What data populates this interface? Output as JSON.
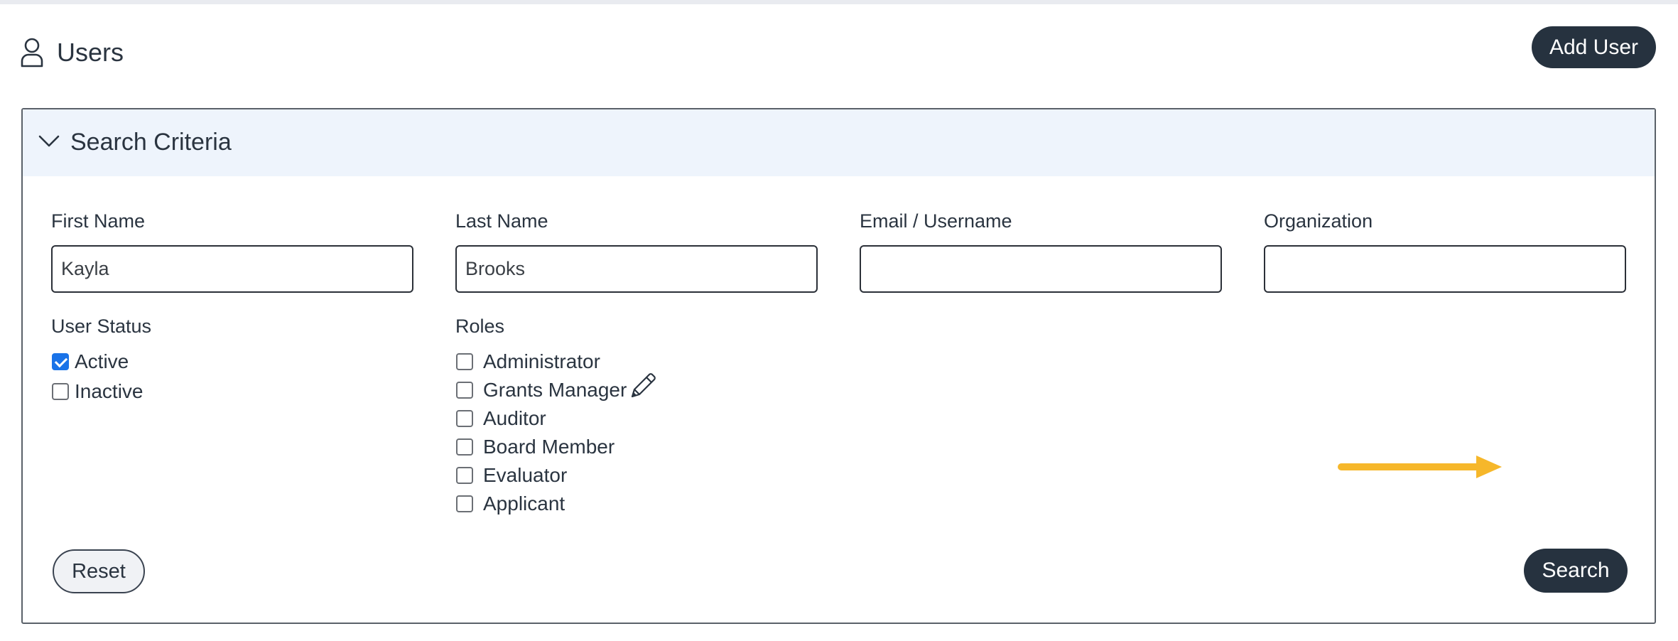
{
  "header": {
    "title": "Users",
    "icon": "user-icon",
    "add_user_label": "Add User"
  },
  "search_panel": {
    "title": "Search Criteria",
    "toggle_icon": "chevron-down-icon",
    "fields": {
      "first_name": {
        "label": "First Name",
        "value": "Kayla"
      },
      "last_name": {
        "label": "Last Name",
        "value": "Brooks"
      },
      "email": {
        "label": "Email / Username",
        "value": ""
      },
      "organization": {
        "label": "Organization",
        "value": ""
      }
    },
    "user_status": {
      "label": "User Status",
      "options": [
        {
          "label": "Active",
          "checked": true
        },
        {
          "label": "Inactive",
          "checked": false
        }
      ]
    },
    "roles": {
      "label": "Roles",
      "options": [
        {
          "label": "Administrator",
          "checked": false
        },
        {
          "label": "Grants Manager",
          "checked": false
        },
        {
          "label": "Auditor",
          "checked": false
        },
        {
          "label": "Board Member",
          "checked": false
        },
        {
          "label": "Evaluator",
          "checked": false
        },
        {
          "label": "Applicant",
          "checked": false
        }
      ]
    },
    "reset_label": "Reset",
    "search_label": "Search"
  },
  "colors": {
    "dark_button": "#26323f",
    "panel_header_bg": "#eef4fc",
    "checkbox_checked": "#1a73e8",
    "annotation_arrow": "#f6b72a"
  }
}
